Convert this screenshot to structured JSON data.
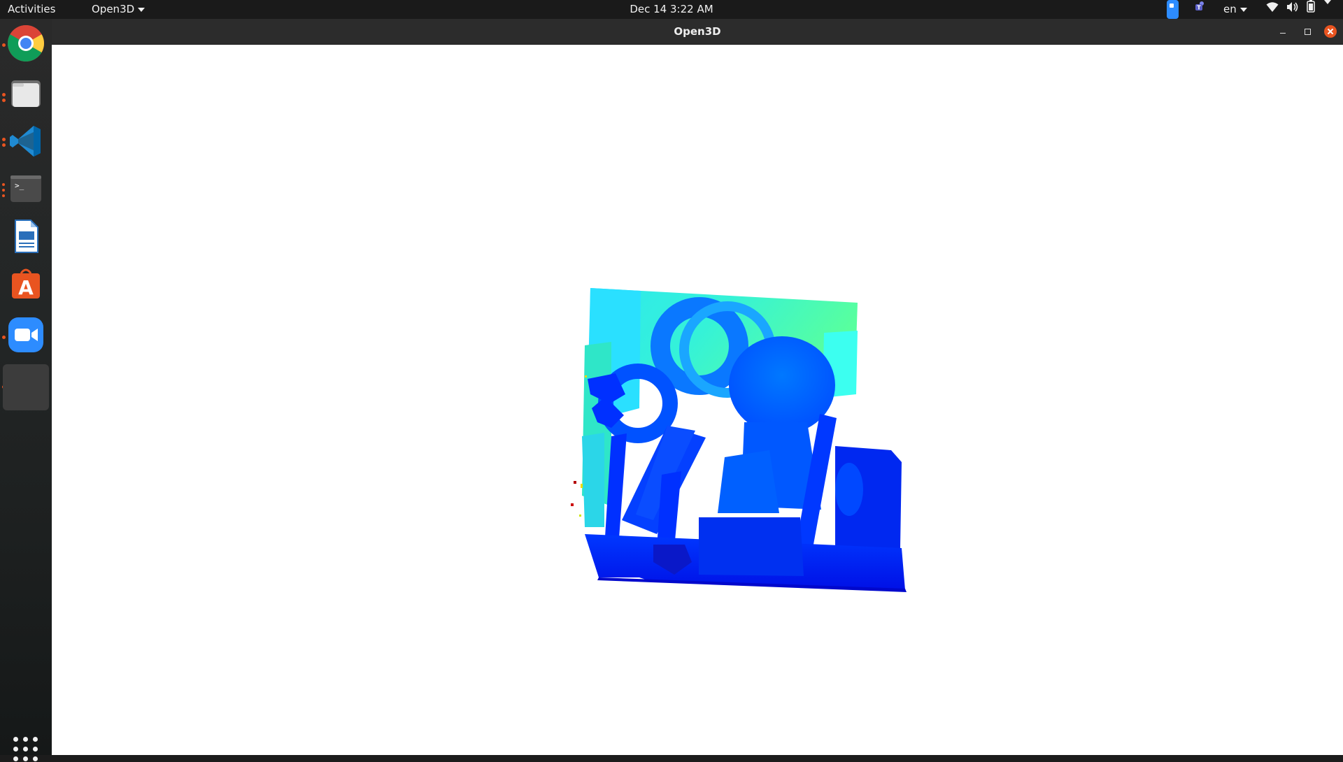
{
  "topbar": {
    "activities": "Activities",
    "app_menu": "Open3D",
    "clock": "Dec 14  3:22 AM",
    "language": "en",
    "tray_icons": [
      "zoom-icon",
      "teams-icon",
      "network-icon",
      "volume-icon",
      "battery-icon",
      "system-menu-icon"
    ]
  },
  "dock": {
    "apps": [
      {
        "name": "Google Chrome",
        "icon": "chrome-icon",
        "running": true
      },
      {
        "name": "Files",
        "icon": "files-icon",
        "running": true
      },
      {
        "name": "Visual Studio Code",
        "icon": "vscode-icon",
        "running": true
      },
      {
        "name": "Terminal",
        "icon": "terminal-icon",
        "running": true
      },
      {
        "name": "LibreOffice Writer",
        "icon": "writer-icon",
        "running": false
      },
      {
        "name": "Ubuntu Software",
        "icon": "software-icon",
        "running": false
      },
      {
        "name": "Zoom",
        "icon": "zoom-icon",
        "running": true
      },
      {
        "name": "Open3D",
        "icon": "open3d-window-icon",
        "running": true
      }
    ],
    "show_apps_icon": "grid-icon"
  },
  "window": {
    "title": "Open3D",
    "controls": [
      "minimize",
      "maximize",
      "close"
    ]
  },
  "viewport": {
    "content": "point-cloud-render",
    "background": "#ffffff"
  }
}
